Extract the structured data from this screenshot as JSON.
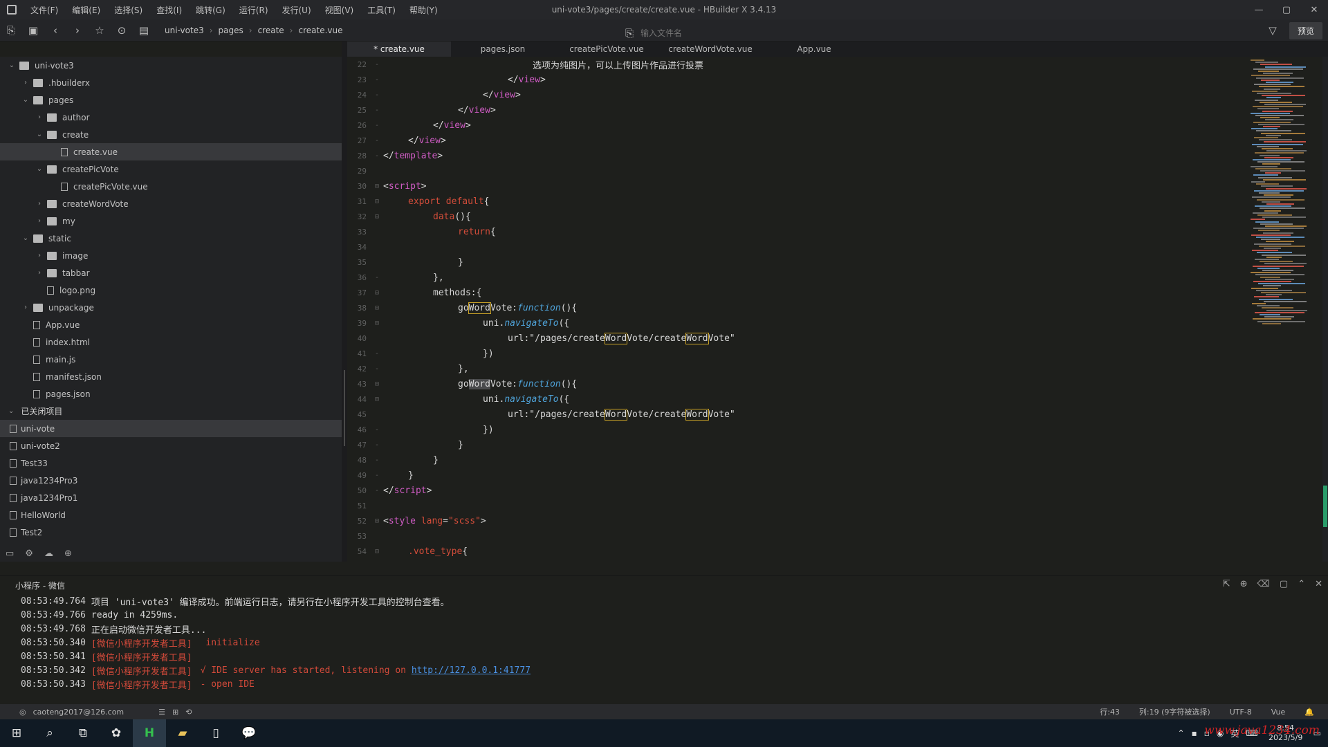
{
  "window": {
    "title": "uni-vote3/pages/create/create.vue - HBuilder X 3.4.13",
    "menu": [
      "文件(F)",
      "编辑(E)",
      "选择(S)",
      "查找(I)",
      "跳转(G)",
      "运行(R)",
      "发行(U)",
      "视图(V)",
      "工具(T)",
      "帮助(Y)"
    ],
    "controls": {
      "minimize": "—",
      "maximize": "▢",
      "close": "✕"
    }
  },
  "toolbar": {
    "breadcrumb": [
      "uni-vote3",
      "pages",
      "create",
      "create.vue"
    ],
    "search_placeholder": "输入文件名",
    "preview_label": "预览",
    "filter_icon": "▽"
  },
  "sidebar": {
    "tree": [
      {
        "label": "uni-vote3",
        "depth": 0,
        "arrow": "⌄",
        "icon": "project"
      },
      {
        "label": ".hbuilderx",
        "depth": 1,
        "arrow": "›",
        "icon": "folder"
      },
      {
        "label": "pages",
        "depth": 1,
        "arrow": "⌄",
        "icon": "folder"
      },
      {
        "label": "author",
        "depth": 2,
        "arrow": "›",
        "icon": "folder"
      },
      {
        "label": "create",
        "depth": 2,
        "arrow": "⌄",
        "icon": "folder"
      },
      {
        "label": "create.vue",
        "depth": 3,
        "arrow": "",
        "icon": "file",
        "selected": true
      },
      {
        "label": "createPicVote",
        "depth": 2,
        "arrow": "⌄",
        "icon": "folder"
      },
      {
        "label": "createPicVote.vue",
        "depth": 3,
        "arrow": "",
        "icon": "file"
      },
      {
        "label": "createWordVote",
        "depth": 2,
        "arrow": "›",
        "icon": "folder"
      },
      {
        "label": "my",
        "depth": 2,
        "arrow": "›",
        "icon": "folder"
      },
      {
        "label": "static",
        "depth": 1,
        "arrow": "⌄",
        "icon": "folder"
      },
      {
        "label": "image",
        "depth": 2,
        "arrow": "›",
        "icon": "folder"
      },
      {
        "label": "tabbar",
        "depth": 2,
        "arrow": "›",
        "icon": "folder"
      },
      {
        "label": "logo.png",
        "depth": 2,
        "arrow": "",
        "icon": "image"
      },
      {
        "label": "unpackage",
        "depth": 1,
        "arrow": "›",
        "icon": "folder"
      },
      {
        "label": "App.vue",
        "depth": 1,
        "arrow": "",
        "icon": "file"
      },
      {
        "label": "index.html",
        "depth": 1,
        "arrow": "",
        "icon": "html"
      },
      {
        "label": "main.js",
        "depth": 1,
        "arrow": "",
        "icon": "file"
      },
      {
        "label": "manifest.json",
        "depth": 1,
        "arrow": "",
        "icon": "file"
      },
      {
        "label": "pages.json",
        "depth": 1,
        "arrow": "",
        "icon": "json"
      }
    ],
    "closed_section": "已关闭项目",
    "closed_projects": [
      {
        "label": "uni-vote",
        "selected": true
      },
      {
        "label": "uni-vote2"
      },
      {
        "label": "Test33"
      },
      {
        "label": "java1234Pro3"
      },
      {
        "label": "java1234Pro1"
      },
      {
        "label": "HelloWorld"
      },
      {
        "label": "Test2"
      }
    ]
  },
  "tabs": [
    {
      "label": "* create.vue",
      "active": true
    },
    {
      "label": "pages.json"
    },
    {
      "label": "createPicVote.vue"
    },
    {
      "label": "createWordVote.vue"
    },
    {
      "label": "App.vue"
    }
  ],
  "code_lines": [
    {
      "n": "22",
      "fold": "-",
      "indent": 6,
      "html": "选项为纯图片，可以上传图片作品进行投票"
    },
    {
      "n": "23",
      "fold": "-",
      "indent": 5,
      "html": "&lt;/<span class='tag'>view</span>&gt;"
    },
    {
      "n": "24",
      "fold": "-",
      "indent": 4,
      "html": "&lt;/<span class='tag'>view</span>&gt;"
    },
    {
      "n": "25",
      "fold": "-",
      "indent": 3,
      "html": "&lt;/<span class='tag'>view</span>&gt;"
    },
    {
      "n": "26",
      "fold": "-",
      "indent": 2,
      "html": "&lt;/<span class='tag'>view</span>&gt;"
    },
    {
      "n": "27",
      "fold": "-",
      "indent": 1,
      "html": "&lt;/<span class='tag'>view</span>&gt;"
    },
    {
      "n": "28",
      "fold": "-",
      "indent": 0,
      "html": "&lt;/<span class='tag'>template</span>&gt;"
    },
    {
      "n": "29",
      "fold": "",
      "indent": 0,
      "html": ""
    },
    {
      "n": "30",
      "fold": "⊟",
      "indent": 0,
      "html": "&lt;<span class='tag'>script</span>&gt;"
    },
    {
      "n": "31",
      "fold": "⊟",
      "indent": 1,
      "html": "<span class='kw'>export default</span>{"
    },
    {
      "n": "32",
      "fold": "⊟",
      "indent": 2,
      "html": "<span class='kw'>data</span>(){"
    },
    {
      "n": "33",
      "fold": "",
      "indent": 3,
      "html": "<span class='kw'>return</span>{"
    },
    {
      "n": "34",
      "fold": "",
      "indent": 0,
      "html": ""
    },
    {
      "n": "35",
      "fold": "",
      "indent": 3,
      "html": "}"
    },
    {
      "n": "36",
      "fold": "-",
      "indent": 2,
      "html": "},"
    },
    {
      "n": "37",
      "fold": "⊟",
      "indent": 2,
      "html": "methods:{"
    },
    {
      "n": "38",
      "fold": "⊟",
      "indent": 3,
      "html": "go<span class='hl'>Word</span>Vote:<span class='fn'>function</span>(){"
    },
    {
      "n": "39",
      "fold": "⊟",
      "indent": 4,
      "html": "uni.<span class='fn'>navigateTo</span>({"
    },
    {
      "n": "40",
      "fold": "",
      "indent": 5,
      "html": "url:\"/pages/create<span class='hl'>Word</span>Vote/create<span class='hl'>Word</span>Vote\""
    },
    {
      "n": "41",
      "fold": "-",
      "indent": 4,
      "html": "})"
    },
    {
      "n": "42",
      "fold": "-",
      "indent": 3,
      "html": "},"
    },
    {
      "n": "43",
      "fold": "⊟",
      "indent": 3,
      "html": "go<span class='hl2'>Word</span>Vote:<span class='fn'>function</span>(){"
    },
    {
      "n": "44",
      "fold": "⊟",
      "indent": 4,
      "html": "uni.<span class='fn'>navigateTo</span>({"
    },
    {
      "n": "45",
      "fold": "",
      "indent": 5,
      "html": "url:\"/pages/create<span class='hl'>Word</span>Vote/create<span class='hl'>Word</span>Vote\""
    },
    {
      "n": "46",
      "fold": "-",
      "indent": 4,
      "html": "})"
    },
    {
      "n": "47",
      "fold": "-",
      "indent": 3,
      "html": "}"
    },
    {
      "n": "48",
      "fold": "-",
      "indent": 2,
      "html": "}"
    },
    {
      "n": "49",
      "fold": "-",
      "indent": 1,
      "html": "}"
    },
    {
      "n": "50",
      "fold": "-",
      "indent": 0,
      "html": "&lt;/<span class='tag'>script</span>&gt;"
    },
    {
      "n": "51",
      "fold": "",
      "indent": 0,
      "html": ""
    },
    {
      "n": "52",
      "fold": "⊟",
      "indent": 0,
      "html": "&lt;<span class='tag'>style</span> <span class='kw'>lang</span>=<span class='kw'>\"scss\"</span>&gt;"
    },
    {
      "n": "53",
      "fold": "",
      "indent": 0,
      "html": ""
    },
    {
      "n": "54",
      "fold": "⊟",
      "indent": 1,
      "html": "<span class='kw'>.vote_type</span>{"
    }
  ],
  "console": {
    "title": "小程序 - 微信",
    "logs": [
      {
        "time": "08:53:49.764",
        "tag": "",
        "msg": "项目 'uni-vote3' 编译成功。前端运行日志，请另行在小程序开发工具的控制台查看。",
        "red": false
      },
      {
        "time": "08:53:49.766",
        "tag": "",
        "msg": "ready in 4259ms.",
        "red": false
      },
      {
        "time": "08:53:49.768",
        "tag": "",
        "msg": "正在启动微信开发者工具...",
        "red": false
      },
      {
        "time": "08:53:50.340",
        "tag": "[微信小程序开发者工具]",
        "msg": " initialize",
        "red": true
      },
      {
        "time": "08:53:50.341",
        "tag": "[微信小程序开发者工具]",
        "msg": "",
        "red": true
      },
      {
        "time": "08:53:50.342",
        "tag": "[微信小程序开发者工具]",
        "msg": "√ IDE server has started, listening on ",
        "red": true,
        "link": "http://127.0.0.1:41777"
      },
      {
        "time": "08:53:50.343",
        "tag": "[微信小程序开发者工具]",
        "msg": "- open IDE",
        "red": true
      }
    ]
  },
  "statusbar": {
    "account": "caoteng2017@126.com",
    "position": "行:43",
    "column": "列:19 (9字符被选择)",
    "encoding": "UTF-8",
    "language": "Vue"
  },
  "taskbar": {
    "clock_time": "8:54",
    "clock_date": "2023/5/9"
  },
  "watermark": "www.java1234.com",
  "colors": {
    "accent_green": "#2a9d6a",
    "tag_pink": "#cf5cc4",
    "keyword_red": "#d34d3a",
    "function_blue": "#4fa3d9",
    "console_red": "#d24a3a"
  }
}
